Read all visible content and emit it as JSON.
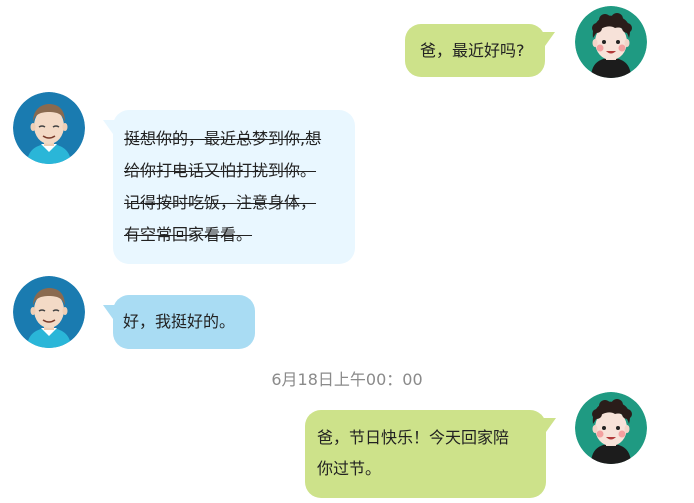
{
  "messages": [
    {
      "sender": "son",
      "lines": [
        "爸，最近好吗?"
      ]
    },
    {
      "sender": "dad",
      "style": "strikethrough",
      "lines": [
        "挺想你的，最近总梦到你,想",
        "给你打电话又怕打扰到你。",
        "记得按时吃饭，注意身体，",
        "有空常回家看看。"
      ]
    },
    {
      "sender": "dad",
      "lines": [
        "好，我挺好的。"
      ]
    },
    {
      "sender": "son",
      "lines": [
        "爸，节日快乐！今天回家陪",
        "你过节。"
      ]
    }
  ],
  "timestamp": "6月18日上午00：00",
  "colors": {
    "son_bubble": "#cde28a",
    "dad_draft_bubble": "#e9f7ff",
    "dad_bubble": "#a9dcf3",
    "timestamp_text": "#8a8a8a"
  },
  "icons": {
    "son_avatar": "cartoon-boy-avatar-icon",
    "dad_avatar": "cartoon-father-avatar-icon"
  }
}
